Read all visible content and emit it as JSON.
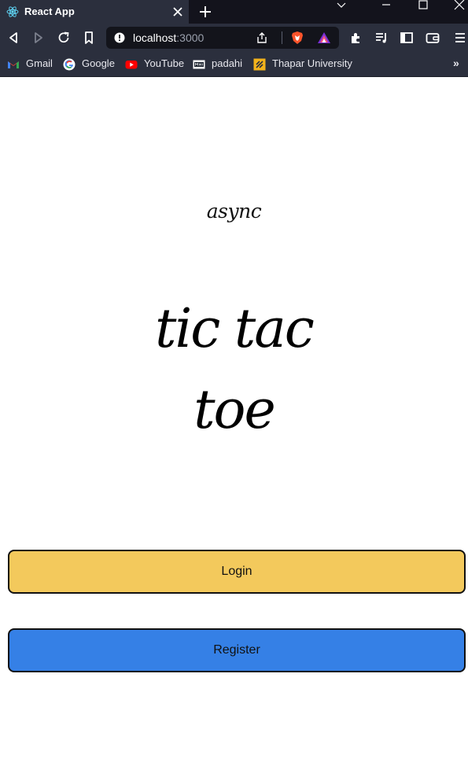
{
  "browser": {
    "tab_title": "React App",
    "url_host": "localhost",
    "url_port": ":3000",
    "bookmarks": [
      {
        "label": "Gmail",
        "icon": "gmail-icon"
      },
      {
        "label": "Google",
        "icon": "google-icon"
      },
      {
        "label": "YouTube",
        "icon": "youtube-icon"
      },
      {
        "label": "padahi",
        "icon": "padahi-icon"
      },
      {
        "label": "Thapar University",
        "icon": "thapar-icon"
      }
    ],
    "more_label": "»"
  },
  "page": {
    "subtitle": "async",
    "title_line1": "tic tac",
    "title_line2": "toe",
    "login_label": "Login",
    "register_label": "Register"
  },
  "colors": {
    "chrome_dark": "#13131c",
    "chrome": "#2b2f3d",
    "login_bg": "#f3c95c",
    "register_bg": "#3580e6"
  }
}
